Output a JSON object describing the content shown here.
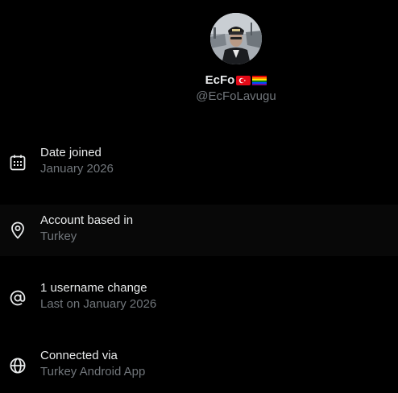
{
  "profile": {
    "display_name": "EcFo",
    "handle": "@EcFoLavugu",
    "name_emojis": [
      "turkey-flag",
      "rainbow-flag"
    ]
  },
  "about_rows": [
    {
      "icon": "calendar-icon",
      "title": "Date joined",
      "value": "January 2026"
    },
    {
      "icon": "location-pin-icon",
      "title": "Account based in",
      "value": "Turkey"
    },
    {
      "icon": "at-sign-icon",
      "title": "1 username change",
      "value": "Last on January 2026"
    },
    {
      "icon": "globe-icon",
      "title": "Connected via",
      "value": "Turkey Android App"
    }
  ],
  "colors": {
    "background": "#000000",
    "primary_text": "#e7e9ea",
    "secondary_text": "#71767b",
    "hover_row": "#080808"
  }
}
